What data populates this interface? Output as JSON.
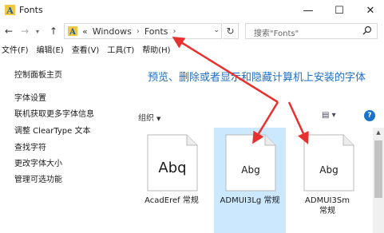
{
  "window": {
    "title": "Fonts",
    "minimize": "—",
    "maximize": "☐",
    "close": "✕"
  },
  "nav": {
    "back": "←",
    "forward": "→",
    "recent": "▾",
    "up": "↑"
  },
  "address": {
    "overflow": "«",
    "segments": [
      "Windows",
      "Fonts"
    ],
    "separator": "›",
    "dropdown": "⌄",
    "refresh": "↻"
  },
  "search": {
    "placeholder": "搜索\"Fonts\""
  },
  "menu": [
    "文件(F)",
    "编辑(E)",
    "查看(V)",
    "工具(T)",
    "帮助(H)"
  ],
  "sidebar": [
    "控制面板主页",
    "字体设置",
    "联机获取更多字体信息",
    "调整 ClearType 文本",
    "查找字符",
    "更改字体大小",
    "管理可选功能"
  ],
  "main": {
    "heading": "预览、删除或者显示和隐藏计算机上安装的字体",
    "organize": "组织",
    "organize_caret": "▼",
    "view": "▤ ▾",
    "help": "?",
    "scroll_up": "▲"
  },
  "fonts": [
    {
      "sample": "Abq",
      "label": "AcadEref 常规",
      "selected": false
    },
    {
      "sample": "Abg",
      "label": "ADMUI3Lg 常规",
      "selected": true
    },
    {
      "sample": "Abg",
      "label": "ADMUI3Sm 常规",
      "selected": false
    }
  ],
  "colors": {
    "accent": "#1e6fc6",
    "selection": "#cce8ff",
    "annotation": "#e8302f",
    "help": "#1a73c9"
  }
}
